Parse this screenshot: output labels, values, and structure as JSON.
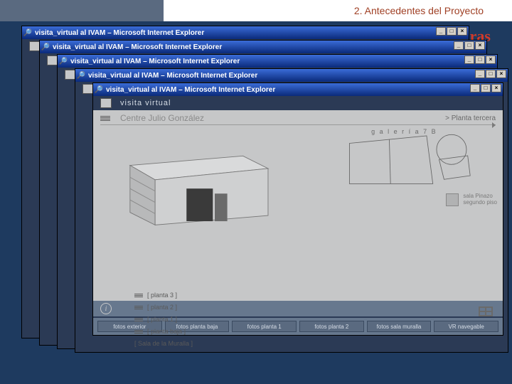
{
  "slide": {
    "section": "2. Antecedentes del Proyecto",
    "partial_red": "ras"
  },
  "ie_common": {
    "title": "visita_virtual al IVAM – Microsoft Internet Explorer",
    "page_label": "visita virtual",
    "min": "_",
    "max": "□",
    "close": "×"
  },
  "front": {
    "center": "Centre Julio González",
    "planta": "> Planta tercera",
    "galeria": "g a l e r í a  7 B",
    "sala_line1": "sala Pinazo",
    "sala_line2": "segundo piso",
    "floors": [
      "[ planta 3 ]",
      "[ planta 2 ]",
      "[ planta 1 ]",
      "[ planta baja ]",
      "[ Sala de la Muralla ]"
    ],
    "info": "i",
    "footer": [
      "fotos exterior",
      "fotos planta baja",
      "fotos planta 1",
      "fotos planta 2",
      "fotos sala muralla",
      "VR navegable"
    ]
  },
  "stubs": {
    "sala6": "[ Sa"
  }
}
